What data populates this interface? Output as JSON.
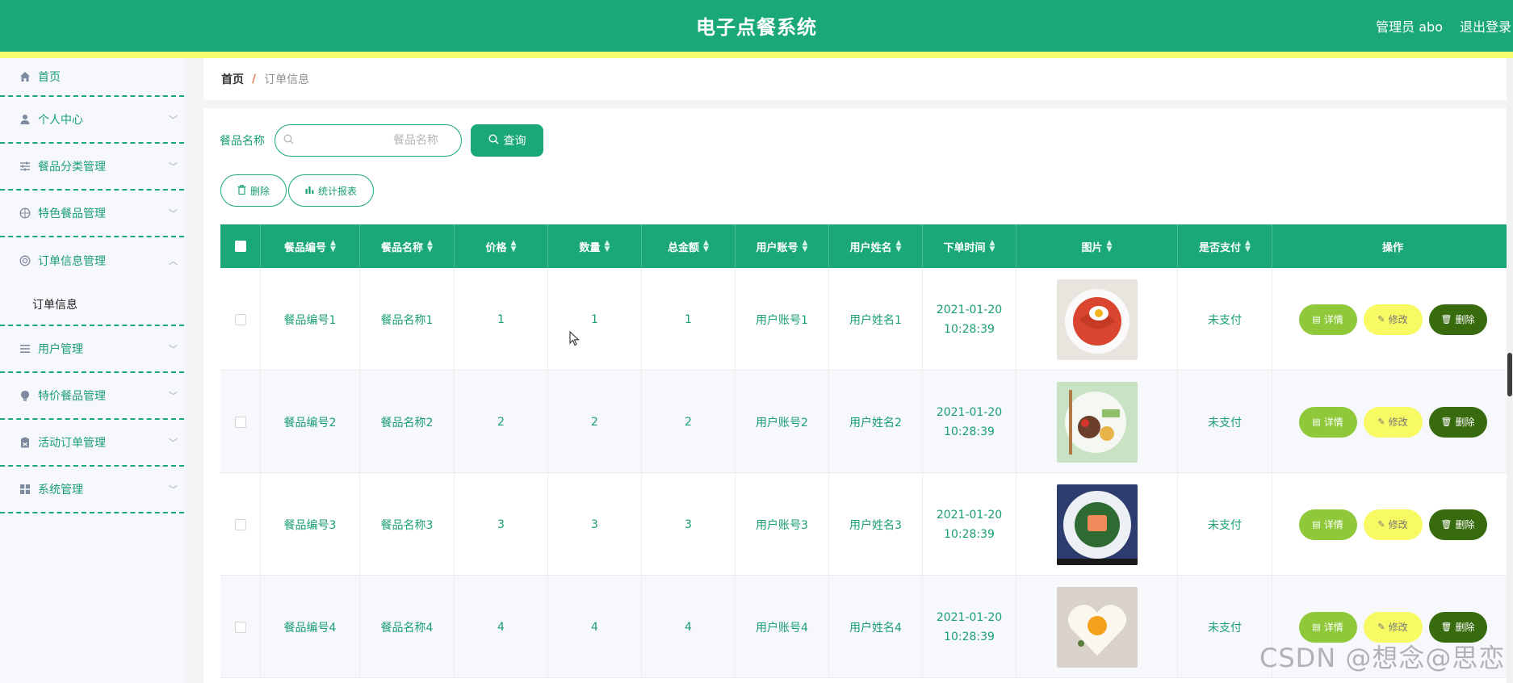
{
  "header": {
    "app_title": "电子点餐系统",
    "admin_label": "管理员 abo",
    "logout_label": "退出登录",
    "brand_color": "#1aa879",
    "strip_color": "#f5ff6e"
  },
  "sidebar": {
    "items": [
      {
        "label": "首页",
        "icon": "home-icon"
      },
      {
        "label": "个人中心",
        "icon": "user-icon"
      },
      {
        "label": "餐品分类管理",
        "icon": "sliders-icon"
      },
      {
        "label": "特色餐品管理",
        "icon": "compass-icon"
      },
      {
        "label": "订单信息管理",
        "icon": "lifebuoy-icon",
        "expanded": true
      },
      {
        "label": "用户管理",
        "icon": "list-icon"
      },
      {
        "label": "特价餐品管理",
        "icon": "bulb-icon"
      },
      {
        "label": "活动订单管理",
        "icon": "clipboard-icon"
      },
      {
        "label": "系统管理",
        "icon": "grid-icon"
      }
    ],
    "submenu": {
      "label": "订单信息"
    }
  },
  "breadcrumb": {
    "home": "首页",
    "separator": "/",
    "current": "订单信息"
  },
  "search": {
    "label": "餐品名称",
    "placeholder": "餐品名称",
    "query_button": "查询"
  },
  "toolbar": {
    "delete_label": "删除",
    "report_label": "统计报表"
  },
  "table": {
    "columns": [
      "餐品编号",
      "餐品名称",
      "价格",
      "数量",
      "总金额",
      "用户账号",
      "用户姓名",
      "下单时间",
      "图片",
      "是否支付",
      "操作"
    ],
    "rows": [
      {
        "code": "餐品编号1",
        "name": "餐品名称1",
        "price": "1",
        "qty": "1",
        "total": "1",
        "account": "用户账号1",
        "username": "用户姓名1",
        "time": "2021-01-20 10:28:39",
        "image": "pasta-with-egg",
        "paid": "未支付"
      },
      {
        "code": "餐品编号2",
        "name": "餐品名称2",
        "price": "2",
        "qty": "2",
        "total": "2",
        "account": "用户账号2",
        "username": "用户姓名2",
        "time": "2021-01-20 10:28:39",
        "image": "salad-plate",
        "paid": "未支付"
      },
      {
        "code": "餐品编号3",
        "name": "餐品名称3",
        "price": "3",
        "qty": "3",
        "total": "3",
        "account": "用户账号3",
        "username": "用户姓名3",
        "time": "2021-01-20 10:28:39",
        "image": "salmon-bowl",
        "paid": "未支付"
      },
      {
        "code": "餐品编号4",
        "name": "餐品名称4",
        "price": "4",
        "qty": "4",
        "total": "4",
        "account": "用户账号4",
        "username": "用户姓名4",
        "time": "2021-01-20 10:28:39",
        "image": "heart-egg",
        "paid": "未支付"
      }
    ],
    "actions": {
      "detail": "详情",
      "edit": "修改",
      "delete": "删除"
    }
  },
  "watermark": "CSDN @想念@思恋"
}
